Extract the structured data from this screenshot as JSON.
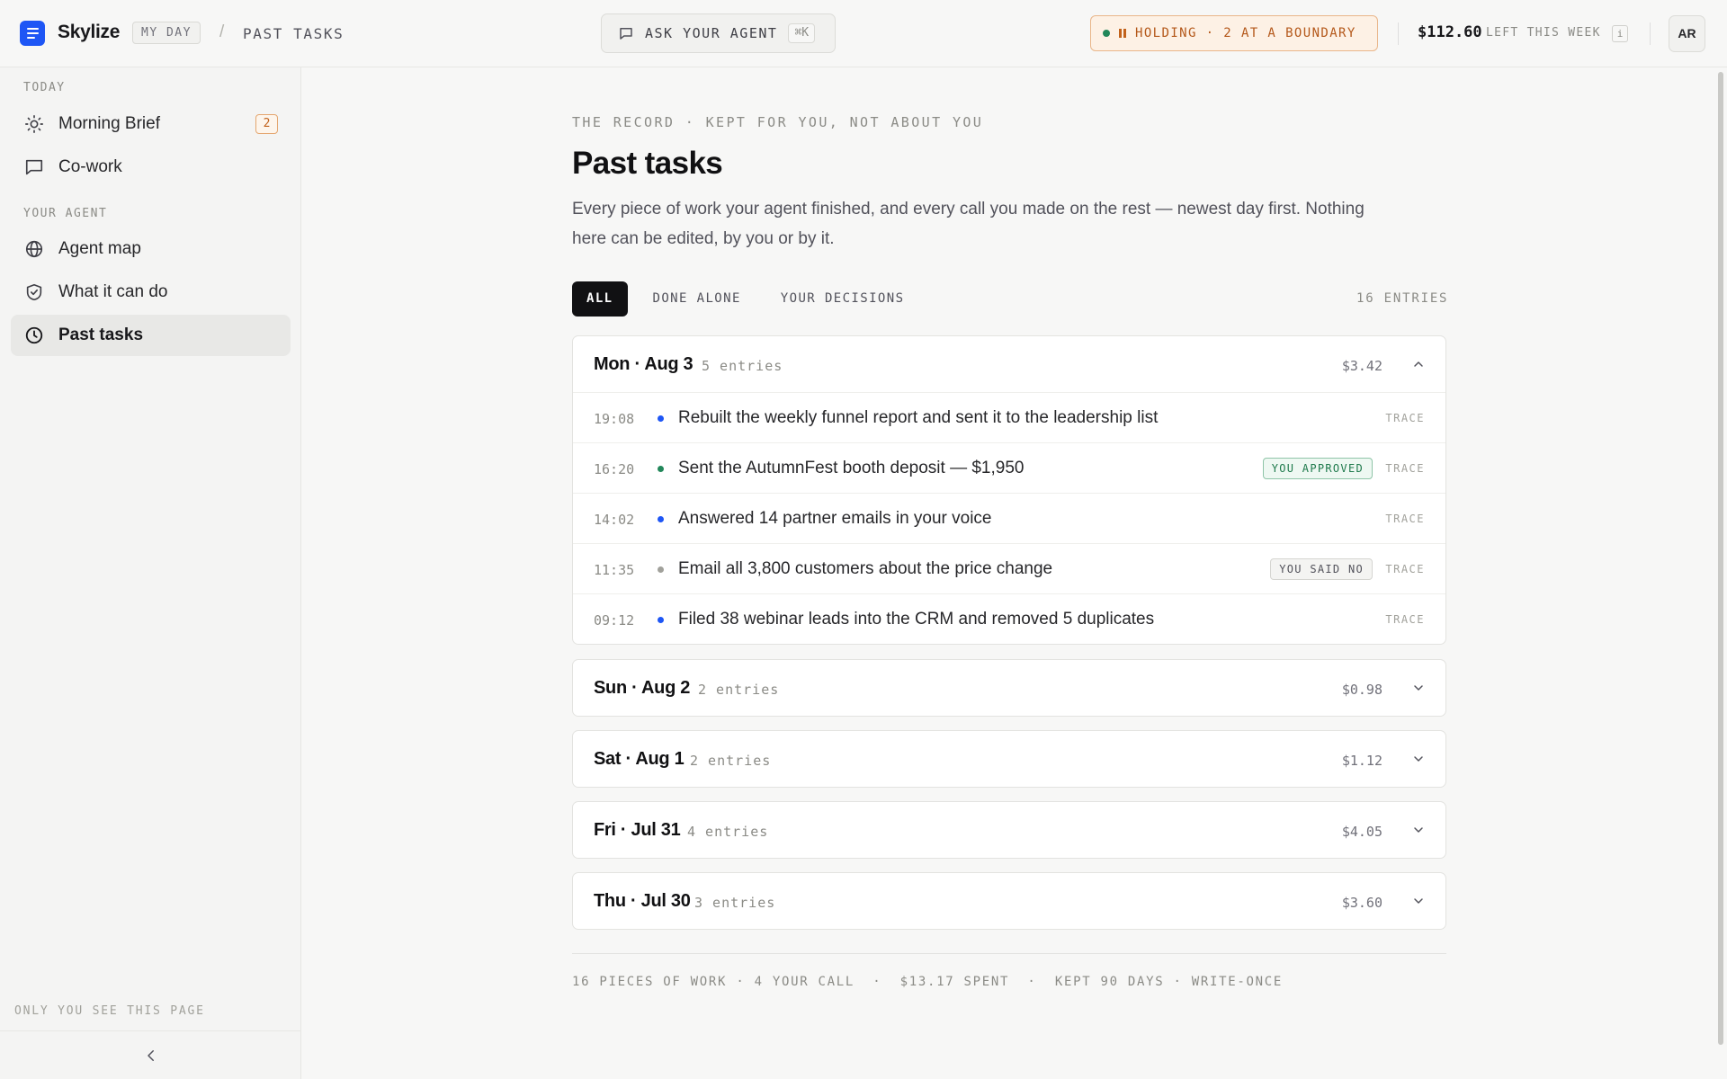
{
  "app": {
    "name": "Skylize",
    "breadcrumb_root": "MY DAY",
    "breadcrumb_sep": "/",
    "breadcrumb_current": "PAST TASKS"
  },
  "header": {
    "ask_label": "ASK YOUR AGENT",
    "ask_shortcut": "⌘K",
    "holding_status": "HOLDING · 2 AT A BOUNDARY",
    "budget_amount": "$112.60",
    "budget_label": "LEFT THIS WEEK",
    "budget_info": "i",
    "avatar_initials": "AR"
  },
  "sidebar": {
    "section_today": "TODAY",
    "section_agent": "YOUR AGENT",
    "items": [
      {
        "label": "Morning Brief",
        "icon": "sun-icon",
        "badge": "2"
      },
      {
        "label": "Co-work",
        "icon": "chat-icon"
      },
      {
        "label": "Agent map",
        "icon": "globe-icon"
      },
      {
        "label": "What it can do",
        "icon": "shield-check-icon"
      },
      {
        "label": "Past tasks",
        "icon": "clock-icon",
        "active": true
      }
    ],
    "footer": "ONLY YOU SEE THIS PAGE"
  },
  "main": {
    "eyebrow": "THE RECORD · KEPT FOR YOU, NOT ABOUT YOU",
    "title": "Past tasks",
    "description": "Every piece of work your agent finished, and every call you made on the rest — newest day first. Nothing here can be edited, by you or by it.",
    "tabs": [
      "ALL",
      "DONE ALONE",
      "YOUR DECISIONS"
    ],
    "active_tab": "ALL",
    "entries_count": "16 ENTRIES",
    "trace_label": "TRACE",
    "days": [
      {
        "title": "Mon · Aug 3",
        "count": "5 entries",
        "cost": "$3.42",
        "expanded": true,
        "entries": [
          {
            "time": "19:08",
            "text": "Rebuilt the weekly funnel report and sent it to the leadership list",
            "dot": "#1e56f5",
            "badge": ""
          },
          {
            "time": "16:20",
            "text": "Sent the AutumnFest booth deposit — $1,950",
            "dot": "#22875a",
            "badge": "YOU APPROVED"
          },
          {
            "time": "14:02",
            "text": "Answered 14 partner emails in your voice",
            "dot": "#1e56f5",
            "badge": ""
          },
          {
            "time": "11:35",
            "text": "Email all 3,800 customers about the price change",
            "dot": "#a1a19b",
            "badge": "YOU SAID NO"
          },
          {
            "time": "09:12",
            "text": "Filed 38 webinar leads into the CRM and removed 5 duplicates",
            "dot": "#1e56f5",
            "badge": ""
          }
        ]
      },
      {
        "title": "Sun · Aug 2",
        "count": "2 entries",
        "cost": "$0.98",
        "expanded": false
      },
      {
        "title": "Sat · Aug 1",
        "count": "2 entries",
        "cost": "$1.12",
        "expanded": false
      },
      {
        "title": "Fri · Jul 31",
        "count": "4 entries",
        "cost": "$4.05",
        "expanded": false
      },
      {
        "title": "Thu · Jul 30",
        "count": "3 entries",
        "cost": "$3.60",
        "expanded": false
      }
    ],
    "footer": "16 PIECES OF WORK · 4 YOUR CALL  ·  $13.17 SPENT  ·  KEPT 90 DAYS · WRITE-ONCE"
  },
  "colors": {
    "accent": "#1e56f5",
    "approved_green": "#1f7a4c",
    "holding_orange": "#c2621b"
  }
}
